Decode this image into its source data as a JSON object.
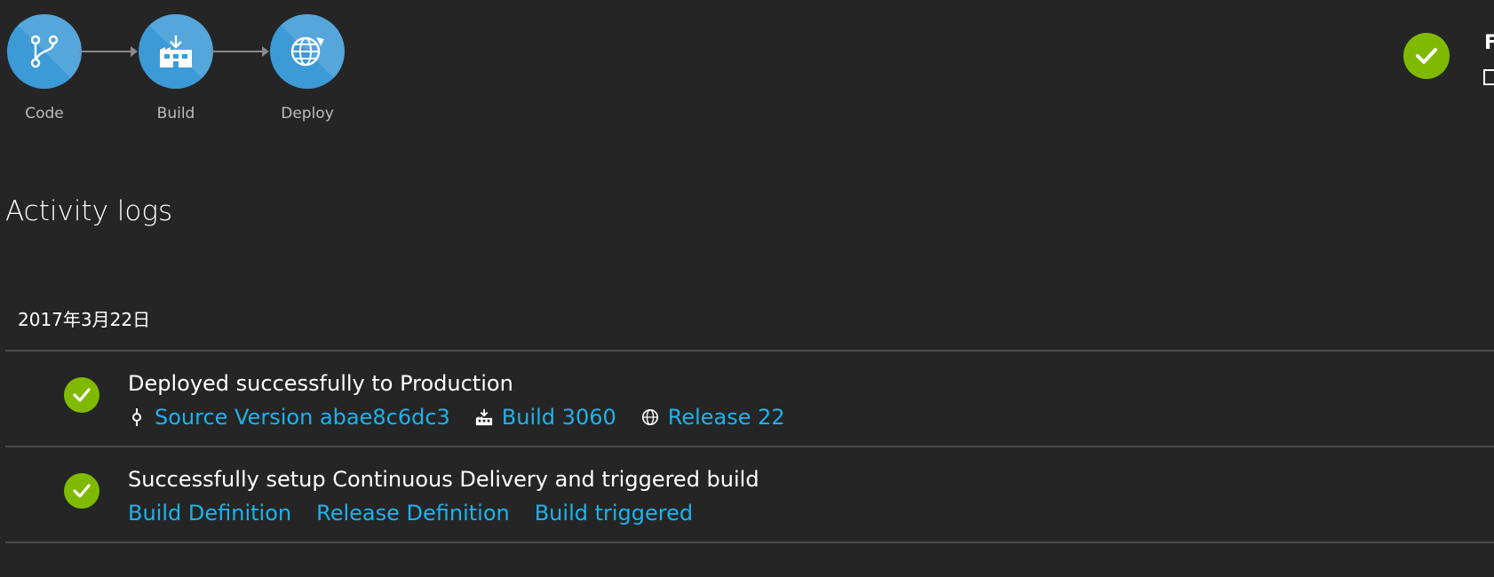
{
  "pipeline": {
    "stages": [
      {
        "label": "Code",
        "icon": "branch-icon"
      },
      {
        "label": "Build",
        "icon": "factory-icon"
      },
      {
        "label": "Deploy",
        "icon": "globe-icon"
      }
    ],
    "status": "success",
    "partial_text": "F"
  },
  "activity": {
    "title": "Activity logs",
    "date": "2017年3月22日",
    "entries": [
      {
        "title": "Deployed successfully to Production",
        "status": "success",
        "links": [
          {
            "icon": "commit-icon",
            "label": "Source Version abae8c6dc3"
          },
          {
            "icon": "build-icon",
            "label": "Build 3060"
          },
          {
            "icon": "globe-icon",
            "label": "Release 22"
          }
        ]
      },
      {
        "title": "Successfully setup Continuous Delivery and triggered build",
        "status": "success",
        "links": [
          {
            "label": "Build Definition"
          },
          {
            "label": "Release Definition"
          },
          {
            "label": "Build triggered"
          }
        ]
      }
    ]
  },
  "colors": {
    "background": "#252526",
    "accent_link": "#1fb2ea",
    "stage_circle": "#3c9ad6",
    "success": "#7fba00"
  }
}
